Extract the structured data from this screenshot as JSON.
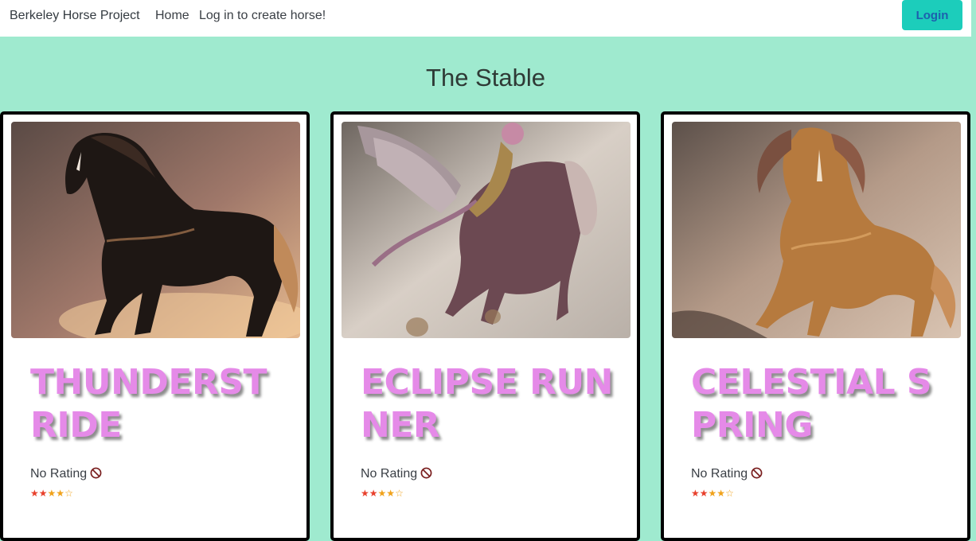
{
  "navbar": {
    "brand": "Berkeley Horse Project",
    "links": [
      {
        "label": "Home"
      },
      {
        "label": "Log in to create horse!"
      }
    ],
    "login_label": "Login"
  },
  "page": {
    "title": "The Stable"
  },
  "horses": [
    {
      "name": "THUNDERSTRIDE",
      "rating_text": "No Rating",
      "stars": 4,
      "max_stars": 5,
      "image_icon": "horse-image"
    },
    {
      "name": "ECLIPSE RUNNER",
      "rating_text": "No Rating",
      "stars": 4,
      "max_stars": 5,
      "image_icon": "horse-image"
    },
    {
      "name": "CELESTIAL SPRING",
      "rating_text": "No Rating",
      "stars": 4,
      "max_stars": 5,
      "image_icon": "horse-image"
    }
  ],
  "colors": {
    "background": "#9feacf",
    "accent": "#1ccdbb",
    "name": "#e58ae8",
    "star": "#e8402c"
  }
}
